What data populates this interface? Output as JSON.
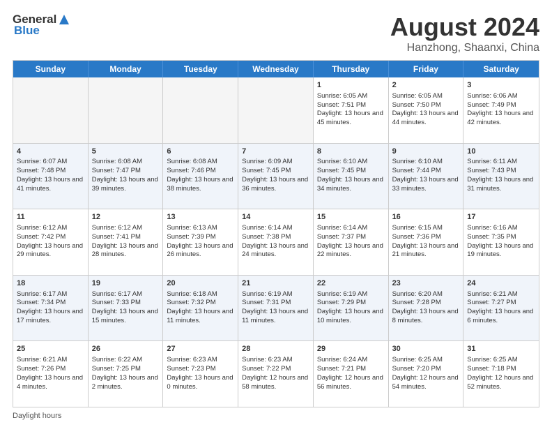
{
  "logo": {
    "general": "General",
    "blue": "Blue"
  },
  "title": "August 2024",
  "subtitle": "Hanzhong, Shaanxi, China",
  "days": [
    "Sunday",
    "Monday",
    "Tuesday",
    "Wednesday",
    "Thursday",
    "Friday",
    "Saturday"
  ],
  "footer": "Daylight hours",
  "rows": [
    [
      {
        "day": "",
        "content": ""
      },
      {
        "day": "",
        "content": ""
      },
      {
        "day": "",
        "content": ""
      },
      {
        "day": "",
        "content": ""
      },
      {
        "day": "1",
        "content": "Sunrise: 6:05 AM\nSunset: 7:51 PM\nDaylight: 13 hours and 45 minutes."
      },
      {
        "day": "2",
        "content": "Sunrise: 6:05 AM\nSunset: 7:50 PM\nDaylight: 13 hours and 44 minutes."
      },
      {
        "day": "3",
        "content": "Sunrise: 6:06 AM\nSunset: 7:49 PM\nDaylight: 13 hours and 42 minutes."
      }
    ],
    [
      {
        "day": "4",
        "content": "Sunrise: 6:07 AM\nSunset: 7:48 PM\nDaylight: 13 hours and 41 minutes."
      },
      {
        "day": "5",
        "content": "Sunrise: 6:08 AM\nSunset: 7:47 PM\nDaylight: 13 hours and 39 minutes."
      },
      {
        "day": "6",
        "content": "Sunrise: 6:08 AM\nSunset: 7:46 PM\nDaylight: 13 hours and 38 minutes."
      },
      {
        "day": "7",
        "content": "Sunrise: 6:09 AM\nSunset: 7:45 PM\nDaylight: 13 hours and 36 minutes."
      },
      {
        "day": "8",
        "content": "Sunrise: 6:10 AM\nSunset: 7:45 PM\nDaylight: 13 hours and 34 minutes."
      },
      {
        "day": "9",
        "content": "Sunrise: 6:10 AM\nSunset: 7:44 PM\nDaylight: 13 hours and 33 minutes."
      },
      {
        "day": "10",
        "content": "Sunrise: 6:11 AM\nSunset: 7:43 PM\nDaylight: 13 hours and 31 minutes."
      }
    ],
    [
      {
        "day": "11",
        "content": "Sunrise: 6:12 AM\nSunset: 7:42 PM\nDaylight: 13 hours and 29 minutes."
      },
      {
        "day": "12",
        "content": "Sunrise: 6:12 AM\nSunset: 7:41 PM\nDaylight: 13 hours and 28 minutes."
      },
      {
        "day": "13",
        "content": "Sunrise: 6:13 AM\nSunset: 7:39 PM\nDaylight: 13 hours and 26 minutes."
      },
      {
        "day": "14",
        "content": "Sunrise: 6:14 AM\nSunset: 7:38 PM\nDaylight: 13 hours and 24 minutes."
      },
      {
        "day": "15",
        "content": "Sunrise: 6:14 AM\nSunset: 7:37 PM\nDaylight: 13 hours and 22 minutes."
      },
      {
        "day": "16",
        "content": "Sunrise: 6:15 AM\nSunset: 7:36 PM\nDaylight: 13 hours and 21 minutes."
      },
      {
        "day": "17",
        "content": "Sunrise: 6:16 AM\nSunset: 7:35 PM\nDaylight: 13 hours and 19 minutes."
      }
    ],
    [
      {
        "day": "18",
        "content": "Sunrise: 6:17 AM\nSunset: 7:34 PM\nDaylight: 13 hours and 17 minutes."
      },
      {
        "day": "19",
        "content": "Sunrise: 6:17 AM\nSunset: 7:33 PM\nDaylight: 13 hours and 15 minutes."
      },
      {
        "day": "20",
        "content": "Sunrise: 6:18 AM\nSunset: 7:32 PM\nDaylight: 13 hours and 11 minutes."
      },
      {
        "day": "21",
        "content": "Sunrise: 6:19 AM\nSunset: 7:31 PM\nDaylight: 13 hours and 11 minutes."
      },
      {
        "day": "22",
        "content": "Sunrise: 6:19 AM\nSunset: 7:29 PM\nDaylight: 13 hours and 10 minutes."
      },
      {
        "day": "23",
        "content": "Sunrise: 6:20 AM\nSunset: 7:28 PM\nDaylight: 13 hours and 8 minutes."
      },
      {
        "day": "24",
        "content": "Sunrise: 6:21 AM\nSunset: 7:27 PM\nDaylight: 13 hours and 6 minutes."
      }
    ],
    [
      {
        "day": "25",
        "content": "Sunrise: 6:21 AM\nSunset: 7:26 PM\nDaylight: 13 hours and 4 minutes."
      },
      {
        "day": "26",
        "content": "Sunrise: 6:22 AM\nSunset: 7:25 PM\nDaylight: 13 hours and 2 minutes."
      },
      {
        "day": "27",
        "content": "Sunrise: 6:23 AM\nSunset: 7:23 PM\nDaylight: 13 hours and 0 minutes."
      },
      {
        "day": "28",
        "content": "Sunrise: 6:23 AM\nSunset: 7:22 PM\nDaylight: 12 hours and 58 minutes."
      },
      {
        "day": "29",
        "content": "Sunrise: 6:24 AM\nSunset: 7:21 PM\nDaylight: 12 hours and 56 minutes."
      },
      {
        "day": "30",
        "content": "Sunrise: 6:25 AM\nSunset: 7:20 PM\nDaylight: 12 hours and 54 minutes."
      },
      {
        "day": "31",
        "content": "Sunrise: 6:25 AM\nSunset: 7:18 PM\nDaylight: 12 hours and 52 minutes."
      }
    ]
  ]
}
